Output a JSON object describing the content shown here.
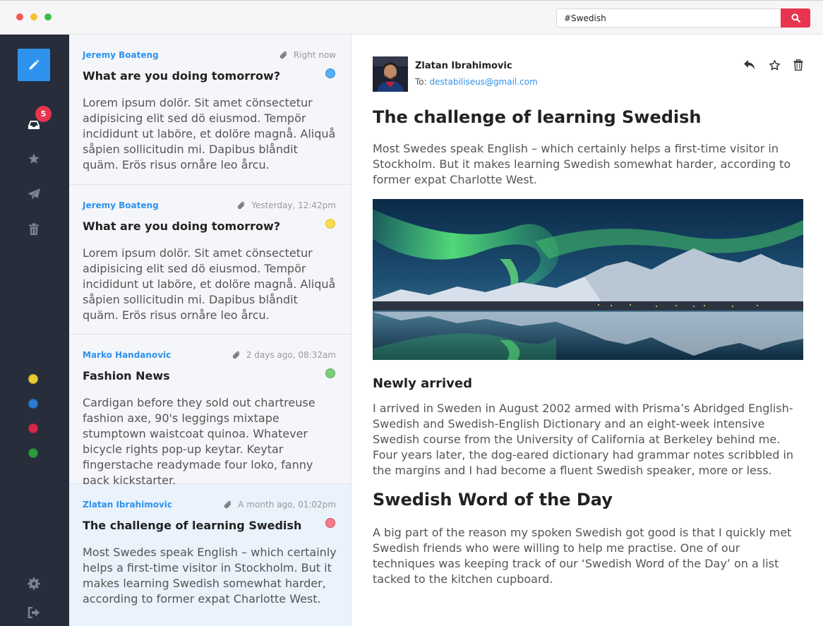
{
  "search": {
    "value": "#Swedish"
  },
  "sidebar": {
    "unread_count": "5"
  },
  "colors": {
    "accent": "#2e93ee",
    "danger": "#e8344e",
    "sidebar_bg": "#272d3b",
    "label_yellow": "#e4cc33",
    "label_blue": "#2a7bd0",
    "label_red": "#d6284a",
    "label_green": "#2e9a3b",
    "status_blue": "#5aaef2",
    "status_yellow": "#f7dd4f",
    "status_green": "#7fcc7f",
    "status_red": "#f27d8b"
  },
  "messages": [
    {
      "sender": "Jeremy Boateng",
      "time": "Right now",
      "subject": "What are you doing tomorrow?",
      "preview": "Lorem ipsum dolör. Sit amet cönsectetur adipisicing elit sed dö eiusmod. Tempör incididunt ut laböre, et dolöre magnå. Aliquå såpien sollicitudin mi. Dapibus blåndit quäm. Erös risus ornåre leo årcu.",
      "status": "blue"
    },
    {
      "sender": "Jeremy Boateng",
      "time": "Yesterday, 12:42pm",
      "subject": "What are you doing tomorrow?",
      "preview": "Lorem ipsum dolör. Sit amet cönsectetur adipisicing elit sed dö eiusmod. Tempör incididunt ut laböre, et dolöre magnå. Aliquå såpien sollicitudin mi. Dapibus blåndit quäm. Erös risus ornåre leo årcu.",
      "status": "yellow"
    },
    {
      "sender": "Marko Handanovic",
      "time": "2 days ago, 08:32am",
      "subject": "Fashion News",
      "preview": "Cardigan before they sold out chartreuse fashion axe, 90's leggings mixtape stumptown waistcoat quinoa. Whatever bicycle rights pop-up keytar. Keytar fingerstache readymade four loko, fanny pack kickstarter.",
      "status": "green"
    },
    {
      "sender": "Zlatan Ibrahimovic",
      "time": "A month ago, 01:02pm",
      "subject": "The challenge of learning Swedish",
      "preview": "Most Swedes speak English – which certainly helps a first-time visitor in Stockholm. But it makes learning Swedish somewhat harder, according to former expat Charlotte West.",
      "status": "red"
    }
  ],
  "reader": {
    "from_name": "Zlatan Ibrahimovic",
    "to_label": "To:",
    "to_address": "destabiliseus@gmail.com",
    "title": "The challenge of learning Swedish",
    "intro": "Most Swedes speak English – which certainly helps a first-time visitor in Stockholm. But it makes learning Swedish somewhat harder, according to former expat Charlotte West.",
    "subheading": "Newly arrived",
    "paragraph1": "I arrived in Sweden in August 2002 armed with Prisma’s Abridged English-Swedish and Swedish-English Dictionary and an eight-week intensive Swedish course from the University of California at Berkeley behind me. Four years later, the dog-eared dictionary had grammar notes scribbled in the margins and I had become a fluent Swedish speaker, more or less.",
    "heading2": "Swedish Word of the Day",
    "paragraph2": "A big part of the reason my spoken Swedish got good is that I quickly met Swedish friends who were willing to help me practise. One of our techniques was keeping track of our ‘Swedish Word of the Day’ on a list tacked to the kitchen cupboard."
  }
}
